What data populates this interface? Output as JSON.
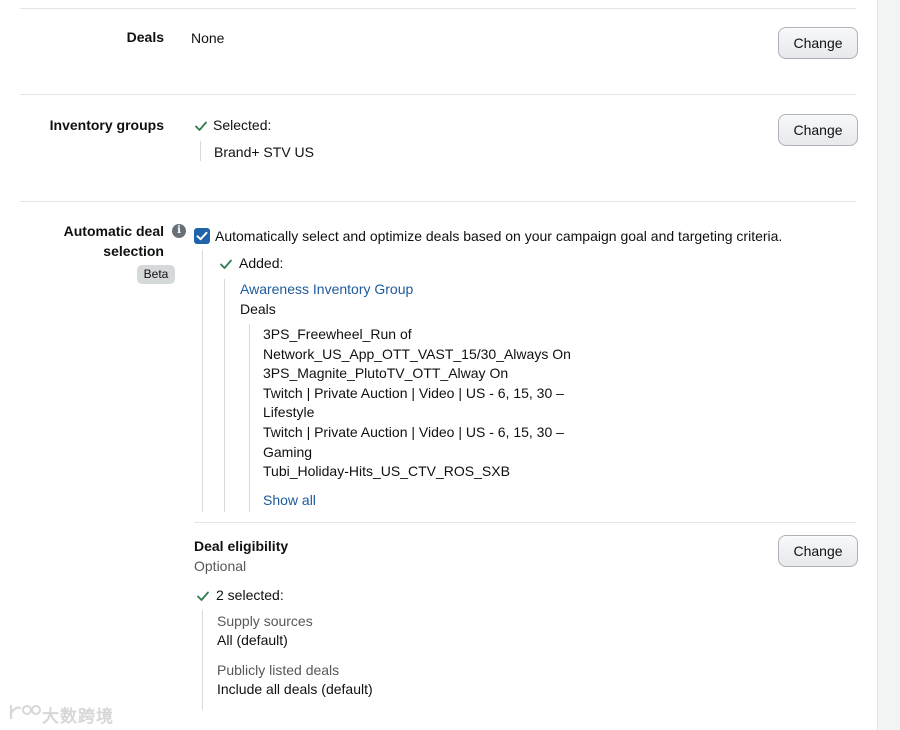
{
  "deals": {
    "label": "Deals",
    "value": "None",
    "button": "Change"
  },
  "inventory_groups": {
    "label": "Inventory groups",
    "status": "Selected:",
    "value": "Brand+ STV US",
    "button": "Change"
  },
  "automatic_deal_selection": {
    "label_line1": "Automatic deal",
    "label_line2": "selection",
    "badge": "Beta",
    "checkbox_text": "Automatically select and optimize deals based on your campaign goal and targeting criteria.",
    "status": "Added:",
    "group_link": "Awareness Inventory Group",
    "deals_heading": "Deals",
    "deal_lines": [
      "3PS_Freewheel_Run of",
      "Network_US_App_OTT_VAST_15/30_Always On",
      "3PS_Magnite_PlutoTV_OTT_Alway On",
      "Twitch | Private Auction | Video | US - 6, 15, 30 –",
      "Lifestyle",
      "Twitch | Private Auction | Video | US - 6, 15, 30 –",
      "Gaming",
      "Tubi_Holiday-Hits_US_CTV_ROS_SXB"
    ],
    "show_all": "Show all"
  },
  "deal_eligibility": {
    "title": "Deal eligibility",
    "subtitle": "Optional",
    "button": "Change",
    "status": "2 selected:",
    "supply_sources_label": "Supply sources",
    "supply_sources_value": "All (default)",
    "public_deals_label": "Publicly listed deals",
    "public_deals_value": "Include all deals (default)"
  },
  "watermark": "大数跨境",
  "icons": {
    "check": "checkmark-icon",
    "info": "info-icon",
    "checkbox": "checked-checkbox-icon"
  },
  "colors": {
    "link": "#1e5a9c",
    "check": "#2e7d4f",
    "checkbox": "#2163a8"
  }
}
